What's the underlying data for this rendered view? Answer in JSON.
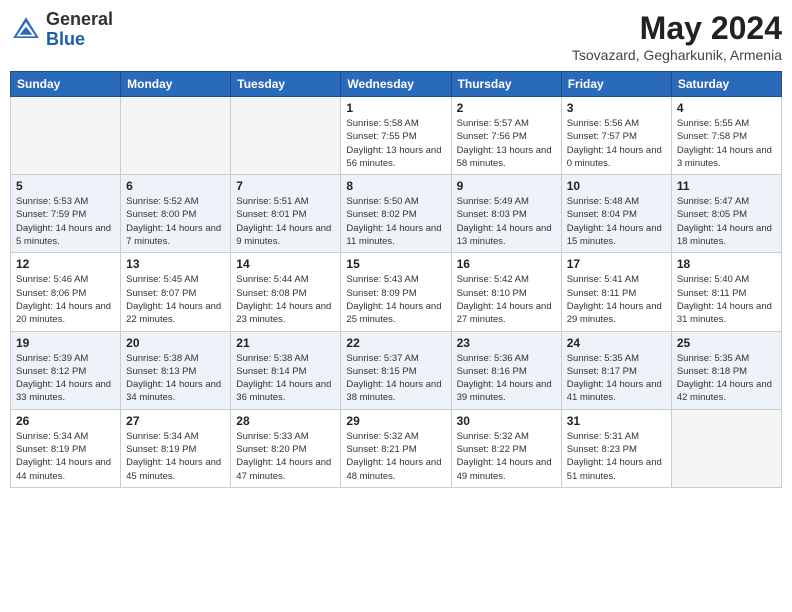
{
  "header": {
    "logo_general": "General",
    "logo_blue": "Blue",
    "month": "May 2024",
    "location": "Tsovazard, Gegharkunik, Armenia"
  },
  "weekdays": [
    "Sunday",
    "Monday",
    "Tuesday",
    "Wednesday",
    "Thursday",
    "Friday",
    "Saturday"
  ],
  "weeks": [
    [
      {
        "day": "",
        "sunrise": "",
        "sunset": "",
        "daylight": ""
      },
      {
        "day": "",
        "sunrise": "",
        "sunset": "",
        "daylight": ""
      },
      {
        "day": "",
        "sunrise": "",
        "sunset": "",
        "daylight": ""
      },
      {
        "day": "1",
        "sunrise": "Sunrise: 5:58 AM",
        "sunset": "Sunset: 7:55 PM",
        "daylight": "Daylight: 13 hours and 56 minutes."
      },
      {
        "day": "2",
        "sunrise": "Sunrise: 5:57 AM",
        "sunset": "Sunset: 7:56 PM",
        "daylight": "Daylight: 13 hours and 58 minutes."
      },
      {
        "day": "3",
        "sunrise": "Sunrise: 5:56 AM",
        "sunset": "Sunset: 7:57 PM",
        "daylight": "Daylight: 14 hours and 0 minutes."
      },
      {
        "day": "4",
        "sunrise": "Sunrise: 5:55 AM",
        "sunset": "Sunset: 7:58 PM",
        "daylight": "Daylight: 14 hours and 3 minutes."
      }
    ],
    [
      {
        "day": "5",
        "sunrise": "Sunrise: 5:53 AM",
        "sunset": "Sunset: 7:59 PM",
        "daylight": "Daylight: 14 hours and 5 minutes."
      },
      {
        "day": "6",
        "sunrise": "Sunrise: 5:52 AM",
        "sunset": "Sunset: 8:00 PM",
        "daylight": "Daylight: 14 hours and 7 minutes."
      },
      {
        "day": "7",
        "sunrise": "Sunrise: 5:51 AM",
        "sunset": "Sunset: 8:01 PM",
        "daylight": "Daylight: 14 hours and 9 minutes."
      },
      {
        "day": "8",
        "sunrise": "Sunrise: 5:50 AM",
        "sunset": "Sunset: 8:02 PM",
        "daylight": "Daylight: 14 hours and 11 minutes."
      },
      {
        "day": "9",
        "sunrise": "Sunrise: 5:49 AM",
        "sunset": "Sunset: 8:03 PM",
        "daylight": "Daylight: 14 hours and 13 minutes."
      },
      {
        "day": "10",
        "sunrise": "Sunrise: 5:48 AM",
        "sunset": "Sunset: 8:04 PM",
        "daylight": "Daylight: 14 hours and 15 minutes."
      },
      {
        "day": "11",
        "sunrise": "Sunrise: 5:47 AM",
        "sunset": "Sunset: 8:05 PM",
        "daylight": "Daylight: 14 hours and 18 minutes."
      }
    ],
    [
      {
        "day": "12",
        "sunrise": "Sunrise: 5:46 AM",
        "sunset": "Sunset: 8:06 PM",
        "daylight": "Daylight: 14 hours and 20 minutes."
      },
      {
        "day": "13",
        "sunrise": "Sunrise: 5:45 AM",
        "sunset": "Sunset: 8:07 PM",
        "daylight": "Daylight: 14 hours and 22 minutes."
      },
      {
        "day": "14",
        "sunrise": "Sunrise: 5:44 AM",
        "sunset": "Sunset: 8:08 PM",
        "daylight": "Daylight: 14 hours and 23 minutes."
      },
      {
        "day": "15",
        "sunrise": "Sunrise: 5:43 AM",
        "sunset": "Sunset: 8:09 PM",
        "daylight": "Daylight: 14 hours and 25 minutes."
      },
      {
        "day": "16",
        "sunrise": "Sunrise: 5:42 AM",
        "sunset": "Sunset: 8:10 PM",
        "daylight": "Daylight: 14 hours and 27 minutes."
      },
      {
        "day": "17",
        "sunrise": "Sunrise: 5:41 AM",
        "sunset": "Sunset: 8:11 PM",
        "daylight": "Daylight: 14 hours and 29 minutes."
      },
      {
        "day": "18",
        "sunrise": "Sunrise: 5:40 AM",
        "sunset": "Sunset: 8:11 PM",
        "daylight": "Daylight: 14 hours and 31 minutes."
      }
    ],
    [
      {
        "day": "19",
        "sunrise": "Sunrise: 5:39 AM",
        "sunset": "Sunset: 8:12 PM",
        "daylight": "Daylight: 14 hours and 33 minutes."
      },
      {
        "day": "20",
        "sunrise": "Sunrise: 5:38 AM",
        "sunset": "Sunset: 8:13 PM",
        "daylight": "Daylight: 14 hours and 34 minutes."
      },
      {
        "day": "21",
        "sunrise": "Sunrise: 5:38 AM",
        "sunset": "Sunset: 8:14 PM",
        "daylight": "Daylight: 14 hours and 36 minutes."
      },
      {
        "day": "22",
        "sunrise": "Sunrise: 5:37 AM",
        "sunset": "Sunset: 8:15 PM",
        "daylight": "Daylight: 14 hours and 38 minutes."
      },
      {
        "day": "23",
        "sunrise": "Sunrise: 5:36 AM",
        "sunset": "Sunset: 8:16 PM",
        "daylight": "Daylight: 14 hours and 39 minutes."
      },
      {
        "day": "24",
        "sunrise": "Sunrise: 5:35 AM",
        "sunset": "Sunset: 8:17 PM",
        "daylight": "Daylight: 14 hours and 41 minutes."
      },
      {
        "day": "25",
        "sunrise": "Sunrise: 5:35 AM",
        "sunset": "Sunset: 8:18 PM",
        "daylight": "Daylight: 14 hours and 42 minutes."
      }
    ],
    [
      {
        "day": "26",
        "sunrise": "Sunrise: 5:34 AM",
        "sunset": "Sunset: 8:19 PM",
        "daylight": "Daylight: 14 hours and 44 minutes."
      },
      {
        "day": "27",
        "sunrise": "Sunrise: 5:34 AM",
        "sunset": "Sunset: 8:19 PM",
        "daylight": "Daylight: 14 hours and 45 minutes."
      },
      {
        "day": "28",
        "sunrise": "Sunrise: 5:33 AM",
        "sunset": "Sunset: 8:20 PM",
        "daylight": "Daylight: 14 hours and 47 minutes."
      },
      {
        "day": "29",
        "sunrise": "Sunrise: 5:32 AM",
        "sunset": "Sunset: 8:21 PM",
        "daylight": "Daylight: 14 hours and 48 minutes."
      },
      {
        "day": "30",
        "sunrise": "Sunrise: 5:32 AM",
        "sunset": "Sunset: 8:22 PM",
        "daylight": "Daylight: 14 hours and 49 minutes."
      },
      {
        "day": "31",
        "sunrise": "Sunrise: 5:31 AM",
        "sunset": "Sunset: 8:23 PM",
        "daylight": "Daylight: 14 hours and 51 minutes."
      },
      {
        "day": "",
        "sunrise": "",
        "sunset": "",
        "daylight": ""
      }
    ]
  ]
}
